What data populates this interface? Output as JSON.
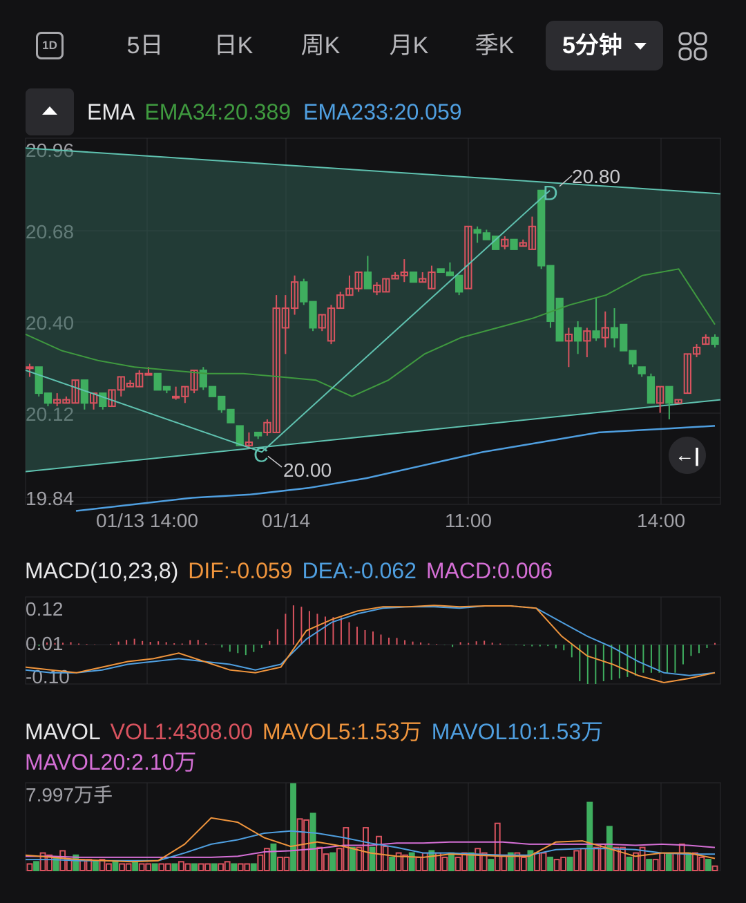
{
  "tabs": {
    "one_day": "1D",
    "items": [
      "5日",
      "日K",
      "周K",
      "月K",
      "季K"
    ],
    "active": "5分钟"
  },
  "legend_ema": {
    "name": "EMA",
    "ema34": "EMA34:20.389",
    "ema233": "EMA233:20.059"
  },
  "legend_macd": {
    "name": "MACD(10,23,8)",
    "dif": "DIF:-0.059",
    "dea": "DEA:-0.062",
    "macd": "MACD:0.006"
  },
  "legend_vol": {
    "name": "MAVOL",
    "vol1": "VOL1:4308.00",
    "mavol5": "MAVOL5:1.53万",
    "mavol10": "MAVOL10:1.53万",
    "mavol20": "MAVOL20:2.10万"
  },
  "colors": {
    "up": "#d9535f",
    "down": "#3fae5f",
    "ema34": "#3f9a3f",
    "ema233": "#4f9fe0",
    "dif": "#f0953d",
    "dea": "#4f9fe0",
    "macd": "#d56fd6",
    "mavol20": "#d56fd6",
    "channel": "#5fc2b0"
  },
  "chart_data": [
    {
      "type": "candlestick",
      "y_ticks": [
        "20.96",
        "20.68",
        "20.40",
        "20.12",
        "19.84"
      ],
      "ylim": [
        19.84,
        20.96
      ],
      "x_ticks": [
        "01/13 14:00",
        "01/14",
        "11:00",
        "14:00"
      ],
      "candles": [
        [
          20.26,
          20.26,
          20.23,
          20.27
        ],
        [
          20.26,
          20.18,
          20.17,
          20.26
        ],
        [
          20.18,
          20.15,
          20.14,
          20.18
        ],
        [
          20.15,
          20.16,
          20.14,
          20.18
        ],
        [
          20.15,
          20.16,
          20.15,
          20.17
        ],
        [
          20.15,
          20.22,
          20.15,
          20.22
        ],
        [
          20.22,
          20.15,
          20.13,
          20.22
        ],
        [
          20.15,
          20.18,
          20.13,
          20.18
        ],
        [
          20.18,
          20.14,
          20.13,
          20.18
        ],
        [
          20.14,
          20.19,
          20.14,
          20.19
        ],
        [
          20.19,
          20.23,
          20.17,
          20.23
        ],
        [
          20.2,
          20.21,
          20.2,
          20.22
        ],
        [
          20.2,
          20.24,
          20.2,
          20.25
        ],
        [
          20.24,
          20.24,
          20.24,
          20.26
        ],
        [
          20.24,
          20.19,
          20.19,
          20.24
        ],
        [
          20.2,
          20.19,
          20.18,
          20.2
        ],
        [
          20.17,
          20.17,
          20.16,
          20.2
        ],
        [
          20.17,
          20.2,
          20.15,
          20.2
        ],
        [
          20.19,
          20.25,
          20.18,
          20.25
        ],
        [
          20.25,
          20.2,
          20.19,
          20.26
        ],
        [
          20.2,
          20.17,
          20.17,
          20.2
        ],
        [
          20.17,
          20.13,
          20.12,
          20.16
        ],
        [
          20.13,
          20.09,
          20.09,
          20.13
        ],
        [
          20.08,
          20.02,
          20.02,
          20.07
        ],
        [
          20.02,
          20.03,
          20.01,
          20.06
        ],
        [
          20.06,
          20.05,
          20.04,
          20.06
        ],
        [
          20.06,
          20.09,
          20.05,
          20.1
        ],
        [
          20.06,
          20.44,
          20.06,
          20.48
        ],
        [
          20.38,
          20.44,
          20.3,
          20.48
        ],
        [
          20.44,
          20.52,
          20.42,
          20.54
        ],
        [
          20.52,
          20.46,
          20.45,
          20.53
        ],
        [
          20.46,
          20.38,
          20.37,
          20.46
        ],
        [
          20.38,
          20.42,
          20.37,
          20.42
        ],
        [
          20.34,
          20.44,
          20.33,
          20.45
        ],
        [
          20.44,
          20.48,
          20.44,
          20.49
        ],
        [
          20.48,
          20.5,
          20.48,
          20.54
        ],
        [
          20.5,
          20.55,
          20.49,
          20.55
        ],
        [
          20.55,
          20.5,
          20.5,
          20.6
        ],
        [
          20.49,
          20.51,
          20.48,
          20.52
        ],
        [
          20.49,
          20.53,
          20.49,
          20.53
        ],
        [
          20.53,
          20.54,
          20.53,
          20.55
        ],
        [
          20.54,
          20.55,
          20.52,
          20.59
        ],
        [
          20.55,
          20.52,
          20.52,
          20.53
        ],
        [
          20.52,
          20.53,
          20.52,
          20.55
        ],
        [
          20.5,
          20.55,
          20.5,
          20.57
        ],
        [
          20.56,
          20.55,
          20.55,
          20.56
        ],
        [
          20.55,
          20.54,
          20.54,
          20.58
        ],
        [
          20.54,
          20.49,
          20.48,
          20.54
        ],
        [
          20.5,
          20.69,
          20.5,
          20.69
        ],
        [
          20.68,
          20.67,
          20.64,
          20.69
        ],
        [
          20.67,
          20.65,
          20.65,
          20.68
        ],
        [
          20.66,
          20.62,
          20.62,
          20.66
        ],
        [
          20.63,
          20.65,
          20.62,
          20.66
        ],
        [
          20.65,
          20.62,
          20.62,
          20.64
        ],
        [
          20.63,
          20.64,
          20.63,
          20.65
        ],
        [
          20.62,
          20.69,
          20.62,
          20.72
        ],
        [
          20.8,
          20.57,
          20.56,
          20.8
        ],
        [
          20.57,
          20.4,
          20.38,
          20.57
        ],
        [
          20.47,
          20.34,
          20.34,
          20.47
        ],
        [
          20.34,
          20.36,
          20.26,
          20.38
        ],
        [
          20.38,
          20.34,
          20.3,
          20.4
        ],
        [
          20.34,
          20.37,
          20.29,
          20.38
        ],
        [
          20.37,
          20.35,
          20.34,
          20.47
        ],
        [
          20.35,
          20.38,
          20.32,
          20.43
        ],
        [
          20.38,
          20.35,
          20.32,
          20.44
        ],
        [
          20.39,
          20.31,
          20.31,
          20.39
        ],
        [
          20.31,
          20.27,
          20.26,
          20.31
        ],
        [
          20.26,
          20.24,
          20.23,
          20.26
        ],
        [
          20.23,
          20.15,
          20.15,
          20.24
        ],
        [
          20.15,
          20.2,
          20.12,
          20.2
        ],
        [
          20.2,
          20.15,
          20.1,
          20.2
        ],
        [
          20.15,
          20.16,
          20.15,
          20.16
        ],
        [
          20.18,
          20.3,
          20.18,
          20.3
        ],
        [
          20.3,
          20.32,
          20.29,
          20.33
        ],
        [
          20.33,
          20.35,
          20.33,
          20.36
        ],
        [
          20.35,
          20.33,
          20.32,
          20.36
        ]
      ],
      "ema34": [
        20.36,
        20.31,
        20.28,
        20.26,
        20.25,
        20.24,
        20.24,
        20.23,
        20.22,
        20.17,
        20.22,
        20.3,
        20.35,
        20.38,
        20.41,
        20.45,
        20.48,
        20.54,
        20.56,
        20.39
      ],
      "ema233": [
        19.82,
        19.84,
        19.86,
        19.87,
        19.89,
        19.92,
        19.96,
        20.0,
        20.03,
        20.06,
        20.07,
        20.08
      ],
      "channel_upper": [
        20.93,
        20.79
      ],
      "channel_lower": [
        19.94,
        20.16
      ],
      "zigzag": [
        20.25,
        20.0,
        20.8
      ],
      "annotations": [
        {
          "label": "C",
          "text": "20.00"
        },
        {
          "label": "D",
          "text": "20.80"
        }
      ]
    },
    {
      "type": "bar",
      "name": "MACD",
      "y_ticks": [
        "0.12",
        "0.01",
        "-0.10"
      ],
      "ylim": [
        -0.14,
        0.17
      ],
      "histogram": [
        0,
        -0.005,
        0.008,
        0.006,
        0.007,
        0.009,
        0.004,
        0.002,
        0.001,
        0,
        0.003,
        0.011,
        0.017,
        0.021,
        0.013,
        0.01,
        0.012,
        0.009,
        0.005,
        0.004,
        0.016,
        0.017,
        0.005,
        0.001,
        -0.01,
        -0.025,
        -0.03,
        -0.037,
        -0.026,
        -0.012,
        0.013,
        0.055,
        0.11,
        0.14,
        0.135,
        0.12,
        0.11,
        0.1,
        0.098,
        0.097,
        0.08,
        0.064,
        0.052,
        0.047,
        0.036,
        0.025,
        0.024,
        0.016,
        0.011,
        0.008,
        0.004,
        0.002,
        -0.001,
        -0.008,
        0.009,
        0.006,
        0.012,
        0.014,
        0.007,
        0.004,
        -0.001,
        -0.002,
        -0.004,
        -0.006,
        -0.006,
        -0.005,
        -0.013,
        -0.02,
        -0.045,
        -0.13,
        -0.14,
        -0.14,
        -0.13,
        -0.125,
        -0.12,
        -0.115,
        -0.11,
        -0.1,
        -0.1,
        -0.1,
        -0.1,
        -0.1,
        -0.07,
        -0.04,
        -0.03,
        -0.012,
        0.006
      ],
      "dif": [
        -0.08,
        -0.09,
        -0.1,
        -0.08,
        -0.06,
        -0.05,
        -0.03,
        -0.06,
        -0.09,
        -0.1,
        -0.08,
        0.05,
        0.09,
        0.12,
        0.135,
        0.135,
        0.14,
        0.135,
        0.138,
        0.138,
        0.13,
        0.03,
        -0.04,
        -0.07,
        -0.11,
        -0.135,
        -0.12,
        -0.1
      ],
      "dea": [
        -0.09,
        -0.1,
        -0.1,
        -0.09,
        -0.07,
        -0.06,
        -0.05,
        -0.06,
        -0.07,
        -0.09,
        -0.07,
        0.02,
        0.08,
        0.11,
        0.13,
        0.135,
        0.135,
        0.13,
        0.138,
        0.138,
        0.13,
        0.08,
        0.03,
        -0.01,
        -0.06,
        -0.1,
        -0.11,
        -0.1
      ]
    },
    {
      "type": "bar",
      "name": "MAVOL",
      "y_ticks": [
        "7.997万手"
      ],
      "ylim": [
        0,
        7.997
      ],
      "volume": [
        0.6,
        0.8,
        1.6,
        1.4,
        1.2,
        1.8,
        1.0,
        1.4,
        1.0,
        1.0,
        0.8,
        1.0,
        0.6,
        0.8,
        0.6,
        0.6,
        0.8,
        0.6,
        0.6,
        0.6,
        0.6,
        0.6,
        0.6,
        0.8,
        0.6,
        0.6,
        0.6,
        0.6,
        0.6,
        0.6,
        0.8,
        0.6,
        0.6,
        0.6,
        0.6,
        1.4,
        2.0,
        2.4,
        1.2,
        1.2,
        7.9,
        4.7,
        4.6,
        5.2,
        2.1,
        1.5,
        1.6,
        2.0,
        3.9,
        2.1,
        2.1,
        3.9,
        2.1,
        3.1,
        2.2,
        1.2,
        1.6,
        1.4,
        1.6,
        1.2,
        1.6,
        1.8,
        1.6,
        1.2,
        1.6,
        1.2,
        1.6,
        1.6,
        2.0,
        1.6,
        1.0,
        4.3,
        1.4,
        1.6,
        1.6,
        1.2,
        1.8,
        1.6,
        1.6,
        1.2,
        1.0,
        1.2,
        1.2,
        1.8,
        2.0,
        6.2,
        2.1,
        2.4,
        4.0,
        2.1,
        2.1,
        1.2,
        1.6,
        2.1,
        1.0,
        1.0,
        1.6,
        1.6,
        1.6,
        2.4,
        1.6,
        1.6,
        1.2,
        1.0,
        0.4
      ],
      "mavol5": [
        1.4,
        1.2,
        1.0,
        0.9,
        0.8,
        0.9,
        2.4,
        4.8,
        4.4,
        3.0,
        2.2,
        2.6,
        2.2,
        1.6,
        1.3,
        1.2,
        1.5,
        1.4,
        1.3,
        1.3,
        2.6,
        2.7,
        2.0,
        1.3,
        1.6,
        1.6,
        1.1
      ],
      "mavol10": [
        1.0,
        1.0,
        0.9,
        0.9,
        0.9,
        0.9,
        1.6,
        2.4,
        2.8,
        3.4,
        3.6,
        3.4,
        3.0,
        2.5,
        2.1,
        1.6,
        1.6,
        1.5,
        1.4,
        1.4,
        1.9,
        2.0,
        2.0,
        1.9,
        1.6,
        1.5,
        1.5
      ],
      "mavol20": [
        1.3,
        1.3,
        1.2,
        1.2,
        1.2,
        1.2,
        1.2,
        1.2,
        1.3,
        1.7,
        1.8,
        2.0,
        2.3,
        2.3,
        2.5,
        2.5,
        2.6,
        2.6,
        2.6,
        2.4,
        2.4,
        2.4,
        2.4,
        2.3,
        2.4,
        2.3,
        2.1
      ]
    }
  ]
}
